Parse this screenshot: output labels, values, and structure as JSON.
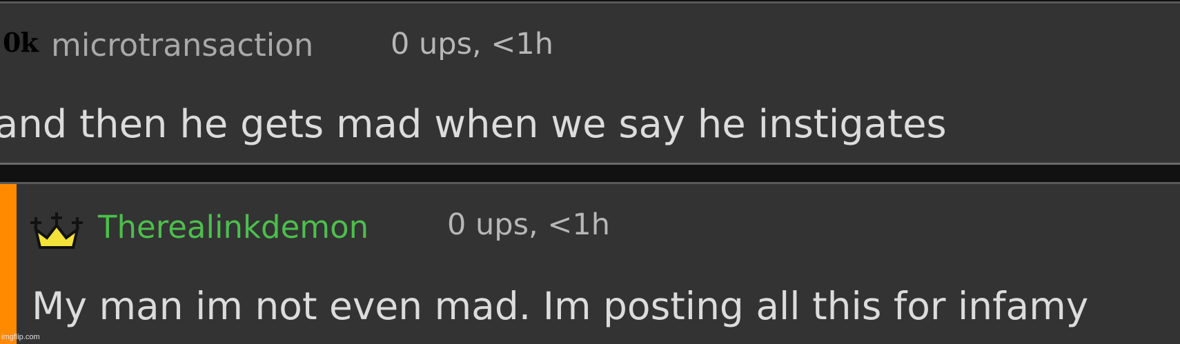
{
  "comments": [
    {
      "badge": "0k",
      "username": "microtransaction",
      "meta": "0 ups, <1h",
      "text": "and then he gets mad when we say he instigates",
      "username_color": "#a9a9a9"
    },
    {
      "icon": "crown-icon",
      "username": "Therealinkdemon",
      "meta": "0 ups, <1h",
      "text": "My man im not even mad. Im posting all this for infamy",
      "username_color": "#4cbf4c",
      "accent_color": "#ff8a00"
    }
  ],
  "watermark": "imgflip.com"
}
